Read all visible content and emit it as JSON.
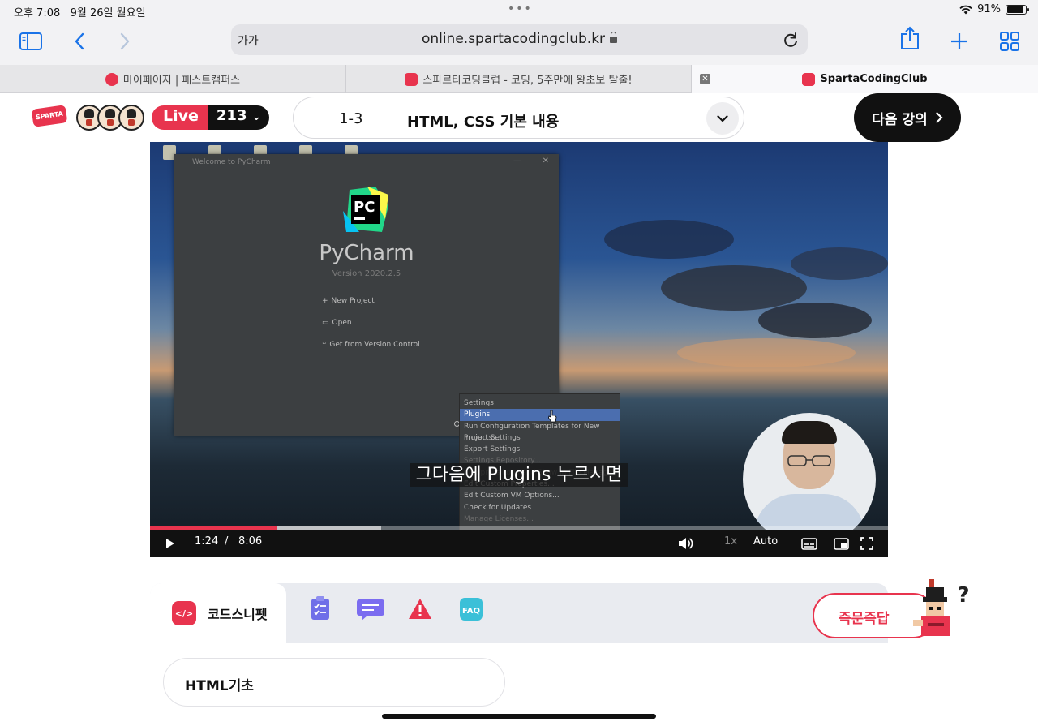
{
  "status_bar": {
    "time": "오후 7:08",
    "date": "9월 26일 월요일",
    "battery": "91%",
    "battery_level": 0.91
  },
  "browser": {
    "text_size_label": "가가",
    "url": "online.spartacodingclub.kr",
    "tabs": [
      {
        "label": "마이페이지 | 패스트캠퍼스",
        "favicon_color": "#e8344e"
      },
      {
        "label": "스파르타코딩클럽 - 코딩, 5주만에 왕초보 탈출!",
        "favicon_color": "#e8344e"
      },
      {
        "label": "SpartaCodingClub",
        "favicon_color": "#e8344e",
        "active": true
      }
    ]
  },
  "header": {
    "logo_text": "SPARTA",
    "live_label": "Live",
    "live_count": "213",
    "lecture_number": "1-3",
    "lecture_title": "HTML, CSS 기본 내용",
    "next_button": "다음 강의"
  },
  "video": {
    "pycharm": {
      "window_title": "Welcome to PyCharm",
      "logo_text": "PC",
      "app_name": "PyCharm",
      "version": "Version 2020.2.5",
      "actions": [
        "New Project",
        "Open",
        "Get from Version Control"
      ]
    },
    "context_menu": [
      {
        "label": "Settings",
        "state": "normal"
      },
      {
        "label": "Plugins",
        "state": "selected"
      },
      {
        "label": "Run Configuration Templates for New Projects...",
        "state": "normal"
      },
      {
        "label": "Import Settings",
        "state": "normal"
      },
      {
        "label": "Export Settings",
        "state": "normal"
      },
      {
        "label": "Settings Repository...",
        "state": "dim"
      },
      {
        "label": "Compress Logs and Show in File Manager",
        "state": "dim"
      },
      {
        "label": "Edit Custom Properties...",
        "state": "normal"
      },
      {
        "label": "Edit Custom VM Options...",
        "state": "normal"
      },
      {
        "label": "Check for Updates",
        "state": "normal"
      },
      {
        "label": "Manage Licenses...",
        "state": "dim"
      }
    ],
    "subtitle": "그다음에 Plugins 누르시면",
    "current_time": "1:24",
    "time_separator": "/",
    "duration": "8:06",
    "played_fraction": 0.173,
    "buffered_fraction": 0.313,
    "speed": "1x",
    "quality": "Auto"
  },
  "panel": {
    "active_tab": "코드스니펫",
    "snippet_icon_text": "</>",
    "faq_label": "FAQ",
    "chapter": "HTML기초"
  },
  "qa_button": "즉문즉답",
  "colors": {
    "brand": "#e8344e",
    "link_blue": "#1a73e8",
    "dark": "#111111"
  }
}
